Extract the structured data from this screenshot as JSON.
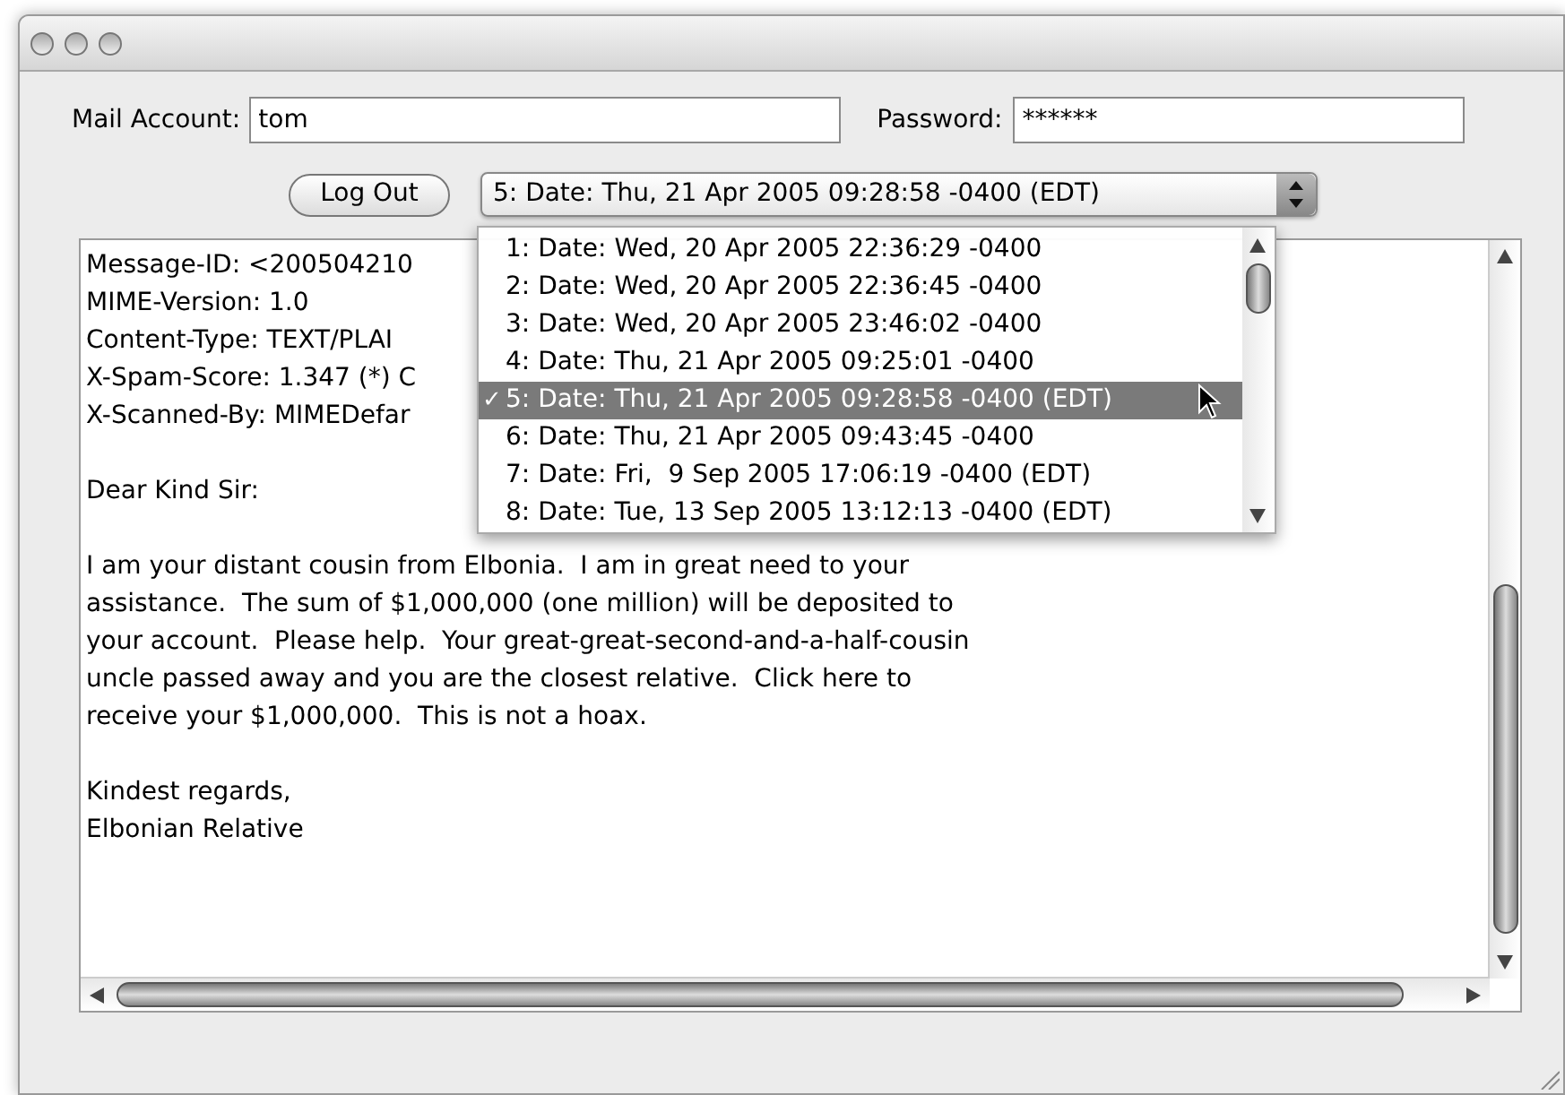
{
  "account": {
    "label": "Mail Account:",
    "value": "tom"
  },
  "password": {
    "label": "Password:",
    "value": "******"
  },
  "logout_button": {
    "label": "Log Out"
  },
  "message_popup": {
    "value": "5: Date: Thu, 21 Apr 2005 09:28:58 -0400 (EDT)"
  },
  "message_menu": {
    "check": "✓",
    "items": [
      {
        "label": "1: Date: Wed, 20 Apr 2005 22:36:29 -0400",
        "selected": false
      },
      {
        "label": "2: Date: Wed, 20 Apr 2005 22:36:45 -0400",
        "selected": false
      },
      {
        "label": "3: Date: Wed, 20 Apr 2005 23:46:02 -0400",
        "selected": false
      },
      {
        "label": "4: Date: Thu, 21 Apr 2005 09:25:01 -0400",
        "selected": false
      },
      {
        "label": "5: Date: Thu, 21 Apr 2005 09:28:58 -0400 (EDT)",
        "selected": true
      },
      {
        "label": "6: Date: Thu, 21 Apr 2005 09:43:45 -0400",
        "selected": false
      },
      {
        "label": "7: Date: Fri,  9 Sep 2005 17:06:19 -0400 (EDT)",
        "selected": false
      },
      {
        "label": "8: Date: Tue, 13 Sep 2005 13:12:13 -0400 (EDT)",
        "selected": false
      }
    ]
  },
  "message": {
    "paragraphs": [
      [
        "Message-ID: <200504210",
        "MIME-Version: 1.0",
        "Content-Type: TEXT/PLAI",
        "X-Spam-Score: 1.347 (*) C",
        "X-Scanned-By: MIMEDefar"
      ],
      [
        "Dear Kind Sir:"
      ],
      [
        "I am your distant cousin from Elbonia.  I am in great need to your",
        "assistance.  The sum of $1,000,000 (one million) will be deposited to",
        "your account.  Please help.  Your great-great-second-and-a-half-cousin",
        "uncle passed away and you are the closest relative.  Click here to",
        "receive your $1,000,000.  This is not a hoax."
      ],
      [
        "Kindest regards,",
        "Elbonian Relative"
      ]
    ]
  }
}
